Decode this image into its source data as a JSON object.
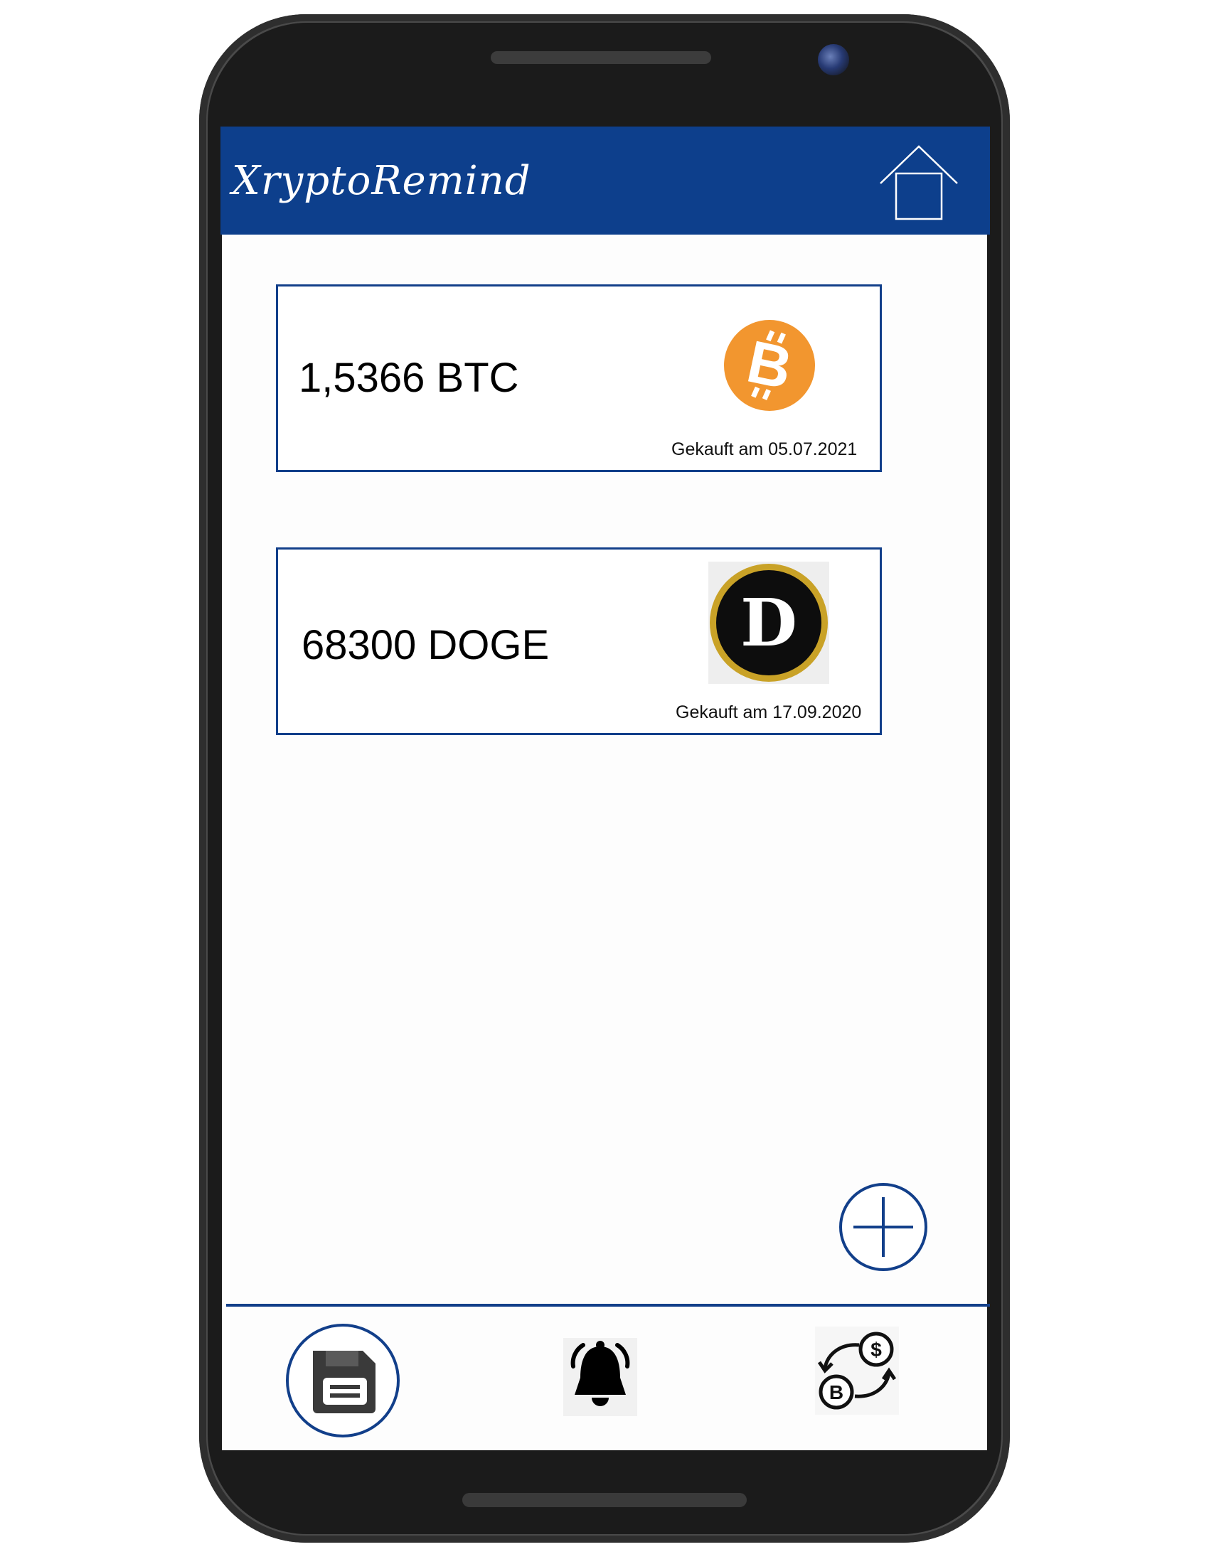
{
  "app": {
    "logo_part1": "Xrypto",
    "logo_part2": "Remind",
    "header_color": "#0d3f8c",
    "accent_color": "#123f8a"
  },
  "holdings": [
    {
      "amount": "1,5366 BTC",
      "purchase_date": "Gekauft am 05.07.2021",
      "icon": "bitcoin-icon",
      "icon_color": "#f2962f"
    },
    {
      "amount": "68300 DOGE",
      "purchase_date": "Gekauft am 17.09.2020",
      "icon": "dogecoin-icon",
      "icon_color": "#c9a227"
    }
  ],
  "actions": {
    "add_icon": "plus-icon",
    "home_icon": "home-icon"
  },
  "bottom_nav": [
    {
      "icon": "save-disk-icon",
      "active": true
    },
    {
      "icon": "bell-icon",
      "active": false
    },
    {
      "icon": "crypto-exchange-icon",
      "active": false
    }
  ]
}
